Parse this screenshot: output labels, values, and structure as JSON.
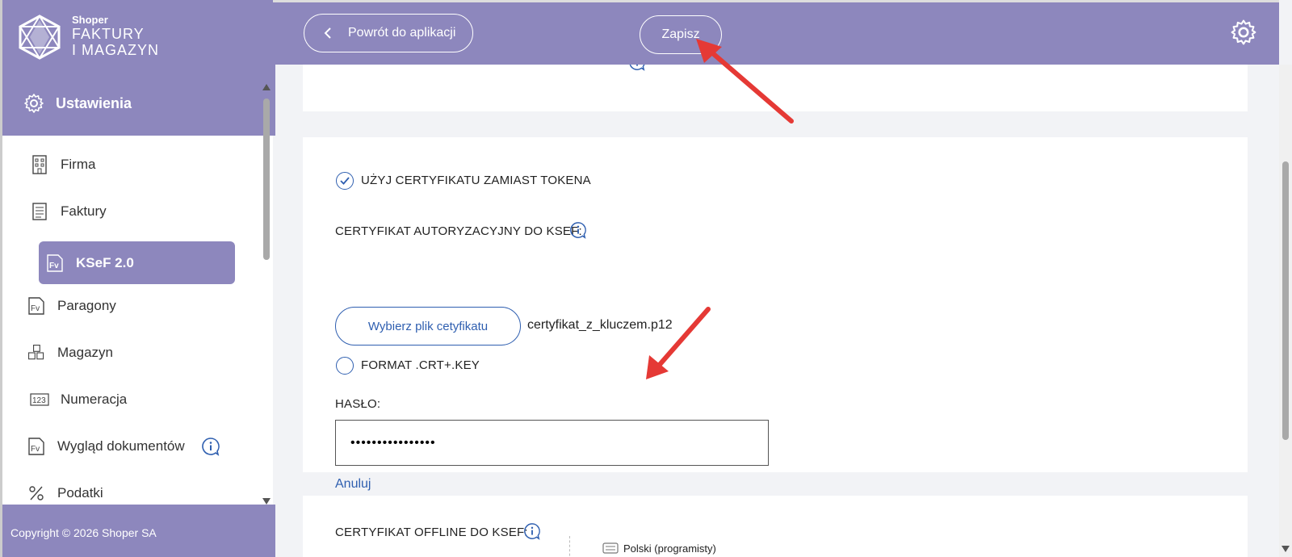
{
  "brand": {
    "small": "Shoper",
    "line1": "FAKTURY",
    "line2": "I MAGAZYN"
  },
  "sidebar": {
    "section_title": "Ustawienia",
    "items": [
      {
        "label": "Firma",
        "icon": "building-icon"
      },
      {
        "label": "Faktury",
        "icon": "document-icon"
      },
      {
        "label": "KSeF 2.0",
        "icon": "fv-icon",
        "active": true
      },
      {
        "label": "Paragony",
        "icon": "fv-icon"
      },
      {
        "label": "Magazyn",
        "icon": "boxes-icon"
      },
      {
        "label": "Numeracja",
        "icon": "numbers-icon"
      },
      {
        "label": "Wygląd dokumentów",
        "icon": "fv-icon",
        "has_info": true
      },
      {
        "label": "Podatki",
        "icon": "tax-icon"
      }
    ],
    "copyright": "Copyright © 2026 Shoper SA"
  },
  "header": {
    "back_label": "Powrót do aplikacji",
    "save_label": "Zapisz"
  },
  "form": {
    "use_certificate_label": "UŻYJ CERTYFIKATU ZAMIAST TOKENA",
    "use_certificate_checked": true,
    "auth_cert_label": "CERTYFIKAT AUTORYZACYJNY DO KSEF:",
    "choose_file_label": "Wybierz plik cetyfikatu",
    "file_name": "certyfikat_z_kluczem.p12",
    "format_label": "FORMAT .CRT+.KEY",
    "format_checked": false,
    "password_label": "HASŁO:",
    "password_value": "••••••••••••••••",
    "cancel_label": "Anuluj",
    "offline_cert_label": "CERTYFIKAT OFFLINE DO KSEF:",
    "keyboard_language": "Polski (programisty)"
  },
  "colors": {
    "brand": "#8d87bd",
    "link": "#2f5fb0",
    "annotation_arrow": "#e53935"
  }
}
